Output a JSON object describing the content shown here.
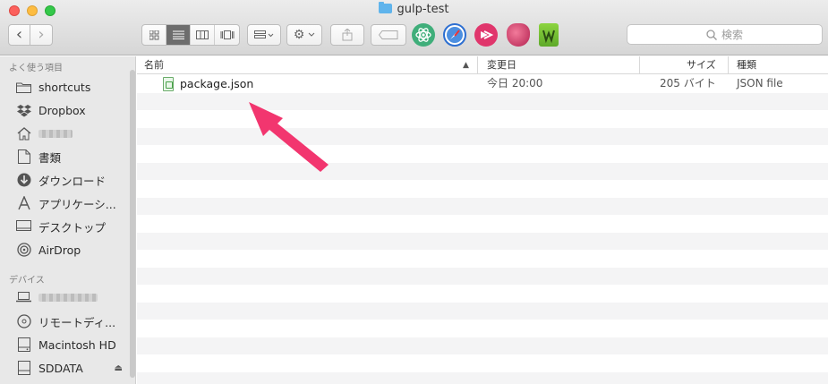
{
  "window": {
    "title": "gulp-test"
  },
  "toolbar": {
    "back_label": "‹",
    "forward_label": "›",
    "search_placeholder": "検索",
    "apps": [
      {
        "icon": "atom-icon",
        "color": "#3fae7a"
      },
      {
        "icon": "safari-icon",
        "color": "#2d6fd1"
      },
      {
        "icon": "skitch-icon",
        "color": "#e0366c"
      },
      {
        "icon": "heart-app-icon",
        "color": "#c9305a"
      },
      {
        "icon": "evernote-w-icon",
        "color": "#6cbf2b"
      }
    ]
  },
  "sidebar": {
    "favorites_header": "よく使う項目",
    "favorites": [
      {
        "label": "shortcuts",
        "icon": "folder-icon"
      },
      {
        "label": "Dropbox",
        "icon": "dropbox-icon"
      },
      {
        "label": "",
        "icon": "home-icon"
      },
      {
        "label": "書類",
        "icon": "documents-icon"
      },
      {
        "label": "ダウンロード",
        "icon": "downloads-icon"
      },
      {
        "label": "アプリケーシ...",
        "icon": "applications-icon"
      },
      {
        "label": "デスクトップ",
        "icon": "desktop-icon"
      },
      {
        "label": "AirDrop",
        "icon": "airdrop-icon"
      }
    ],
    "devices_header": "デバイス",
    "devices": [
      {
        "label": "",
        "icon": "laptop-icon"
      },
      {
        "label": "リモートディ...",
        "icon": "remote-disc-icon"
      },
      {
        "label": "Macintosh HD",
        "icon": "hard-drive-icon"
      },
      {
        "label": "SDDATA",
        "icon": "sd-card-icon"
      }
    ]
  },
  "list": {
    "columns": {
      "name": "名前",
      "modified": "変更日",
      "size": "サイズ",
      "kind": "種類"
    },
    "files": [
      {
        "name": "package.json",
        "modified": "今日 20:00",
        "size": "205 バイト",
        "kind": "JSON file"
      }
    ]
  },
  "annotation": {
    "arrow_color": "#f2366f"
  }
}
